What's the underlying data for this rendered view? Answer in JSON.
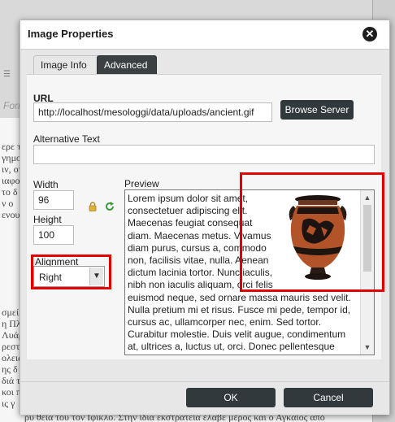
{
  "background": {
    "lines": [
      "ερε τα ν",
      "γημο",
      "ιν, οτι",
      "ιαφο",
      "το δ",
      "ν ο",
      "ενου",
      "σμεί",
      "η Πλ",
      "Λυάρ",
      "ρεστ",
      "ολεις.",
      "ης δ",
      "διά τ",
      "κοι π",
      "ις γ"
    ],
    "side_placeholder": "Form",
    "bottom_line": "ρυ θεία του τον Ιφικλο. Στην ίδια εκστρατεία έλαβε μέρος και ο Αγκαίος από"
  },
  "dialog": {
    "title": "Image Properties",
    "close_icon": "close-icon",
    "tabs": [
      {
        "label": "Image Info",
        "active": true
      },
      {
        "label": "Advanced",
        "active": false
      }
    ],
    "url_label": "URL",
    "url_value": "http://localhost/mesologgi/data/uploads/ancient.gif",
    "browse_label": "Browse Server",
    "alt_label": "Alternative Text",
    "alt_value": "",
    "width_label": "Width",
    "width_value": "96",
    "height_label": "Height",
    "height_value": "100",
    "lock_icon": "lock-icon",
    "reset_icon": "reset-size-icon",
    "alignment_label": "Alignment",
    "alignment_value": "Right",
    "preview_label": "Preview",
    "preview_text": "Lorem ipsum dolor sit amet, consectetuer adipiscing elit. Maecenas feugiat consequat diam. Maecenas metus. Vivamus diam purus, cursus a, commodo non, facilisis vitae, nulla. Aenean dictum lacinia tortor. Nunc iaculis, nibh non iaculis aliquam, orci felis euismod neque, sed ornare massa mauris sed velit. Nulla pretium mi et risus. Fusce mi pede, tempor id, cursus ac, ullamcorper nec, enim. Sed tortor. Curabitur molestie. Duis velit augue, condimentum at, ultrices a, luctus ut, orci. Donec pellentesque egestas eros.",
    "ok_label": "OK",
    "cancel_label": "Cancel"
  },
  "colors": {
    "highlight": "#e20000",
    "dark_button": "#31393c"
  }
}
